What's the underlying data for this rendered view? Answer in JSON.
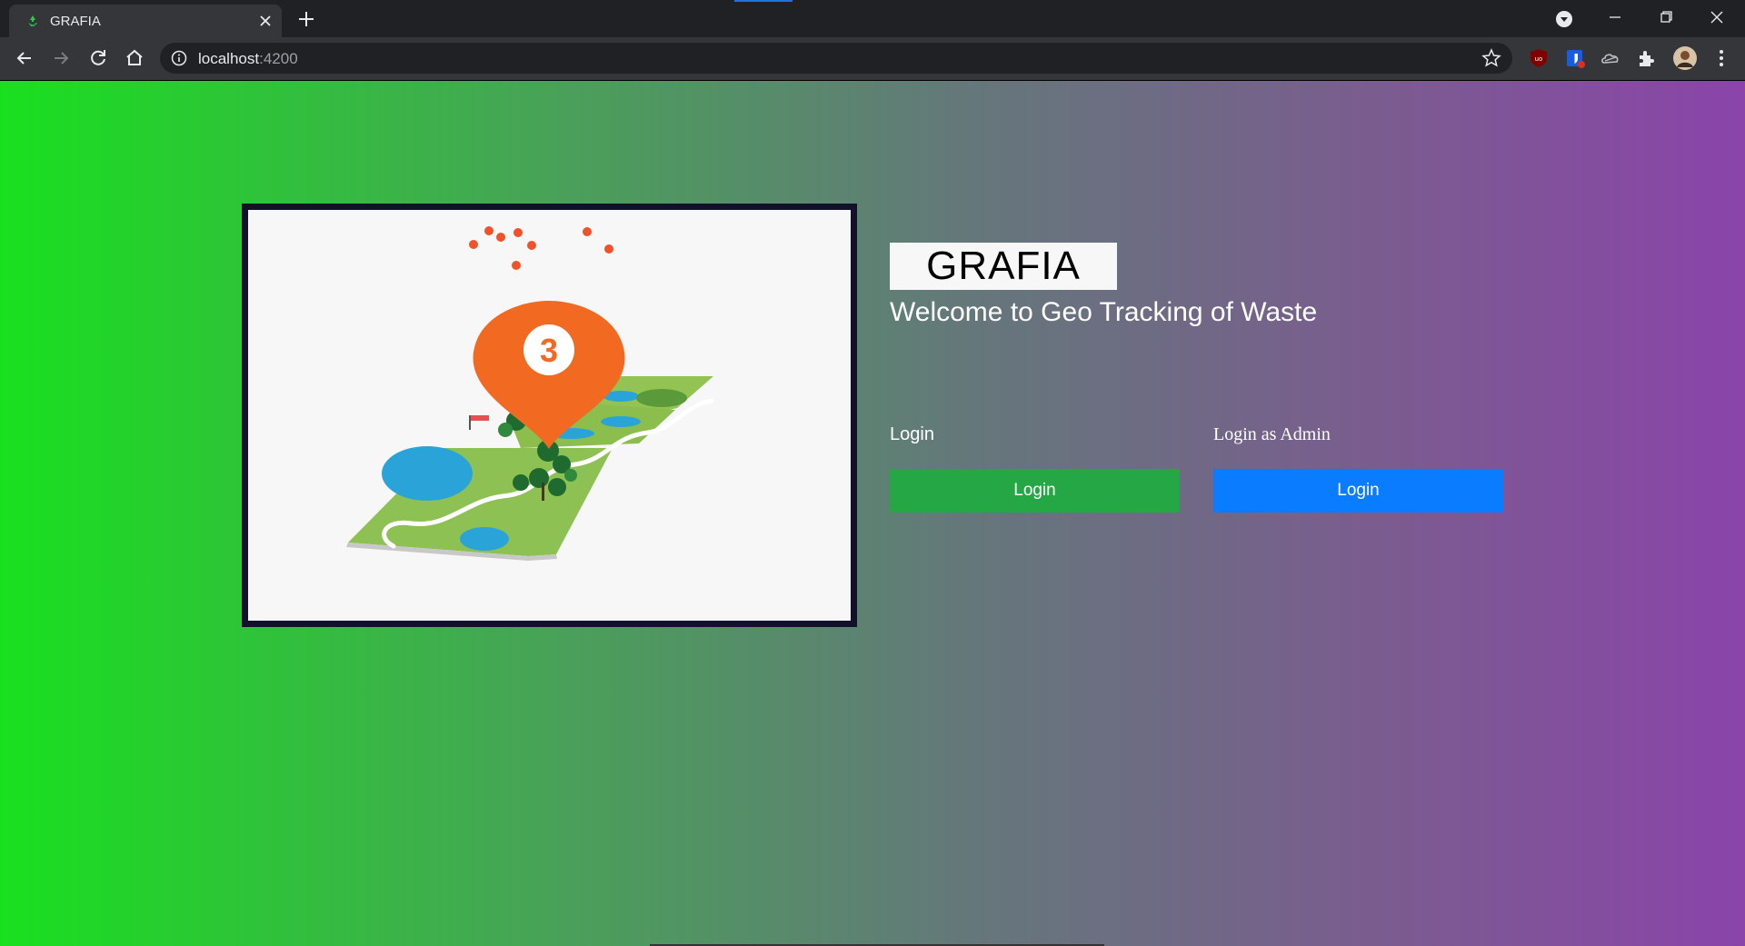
{
  "browser": {
    "tab_title": "GRAFIA",
    "url_host": "localhost",
    "url_port": ":4200"
  },
  "page": {
    "brand": "GRAFIA",
    "welcome": "Welcome to Geo Tracking of Waste",
    "hero_pin_number": "3",
    "user_section_label": "Login",
    "user_button_label": "Login",
    "admin_section_label": "Login as Admin",
    "admin_button_label": "Login"
  },
  "colors": {
    "gradient_start": "#19e01f",
    "gradient_end": "#8a44aa",
    "user_button": "#25a745",
    "admin_button": "#0a7cff"
  }
}
